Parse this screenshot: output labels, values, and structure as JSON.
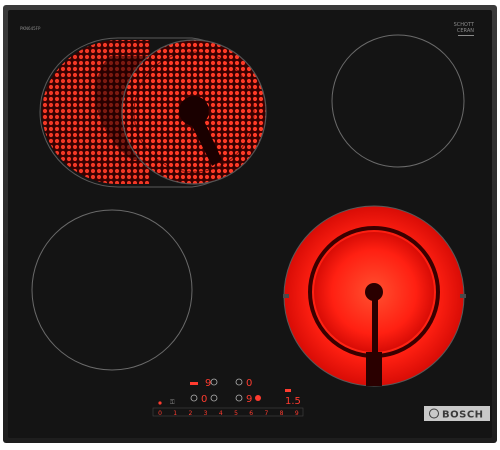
{
  "product": {
    "brand": "BOSCH",
    "glass_brand_line1": "SCHOTT",
    "glass_brand_line2": "CERAN",
    "model_print": "PKN645FP"
  },
  "colors": {
    "glass": "#161616",
    "frame": "#2b2b2b",
    "hot_red": "#ff2a1a",
    "coil_dark": "#7a0000",
    "zone_outline": "#6a6a6a",
    "display_red": "#ff3b2f",
    "badge_bg": "#c9c9c9"
  },
  "zones": [
    {
      "name": "front-left-zone",
      "state": "off"
    },
    {
      "name": "back-left-dual-zone",
      "state": "on"
    },
    {
      "name": "back-right-zone",
      "state": "off"
    },
    {
      "name": "front-right-extended-zone",
      "state": "on"
    }
  ],
  "controls": {
    "zone_displays": [
      {
        "name": "display-back-left",
        "value": "9"
      },
      {
        "name": "display-back-right",
        "value": "0"
      },
      {
        "name": "display-front-left",
        "value": "0"
      },
      {
        "name": "display-front-right",
        "value": "9"
      }
    ],
    "timer_display": "1.5",
    "slider_scale": [
      "0",
      "1",
      "2",
      "3",
      "4",
      "5",
      "6",
      "7",
      "8",
      "9"
    ]
  }
}
